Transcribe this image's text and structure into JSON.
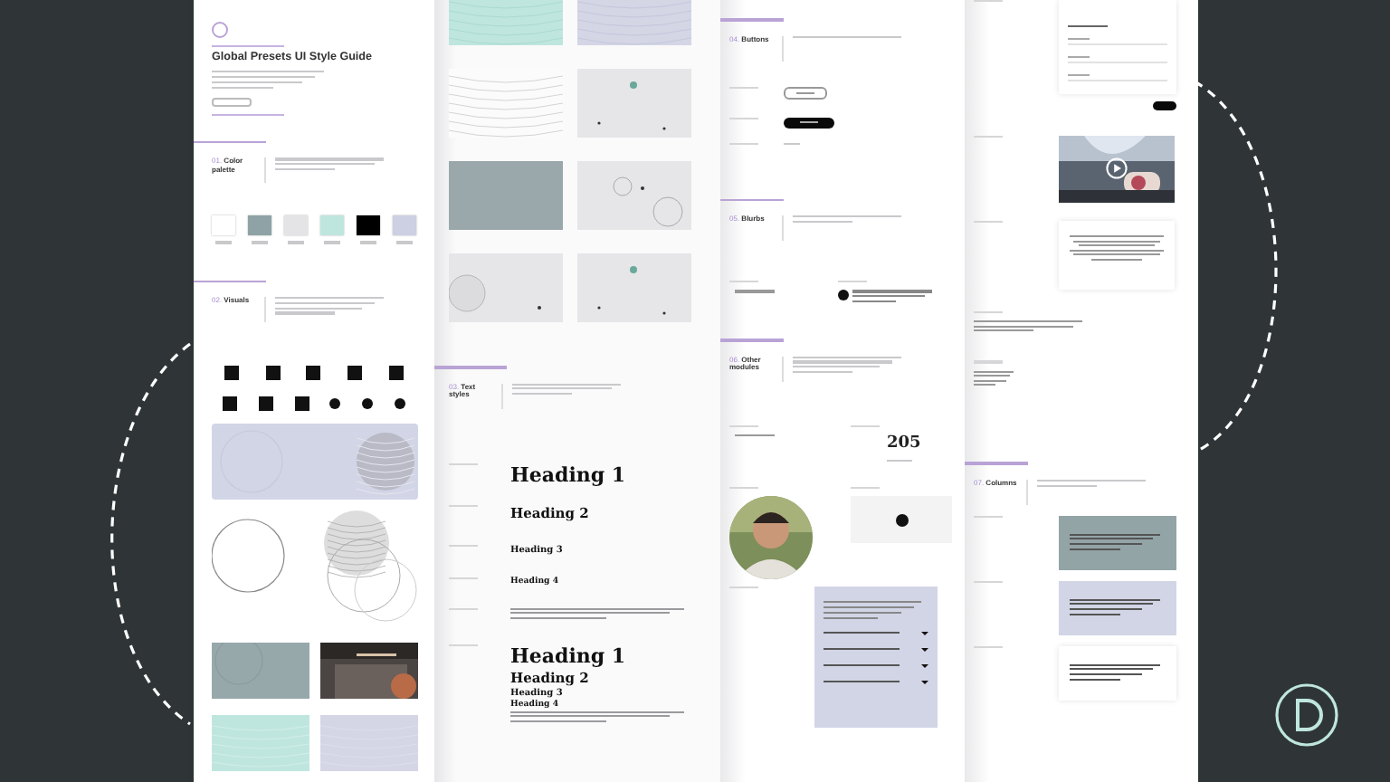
{
  "style_guide": {
    "title": "Global Presets UI Style Guide"
  },
  "sections": [
    {
      "number": "01.",
      "name": "Color palette"
    },
    {
      "number": "02.",
      "name": "Visuals"
    },
    {
      "number": "03.",
      "name": "Text styles"
    },
    {
      "number": "04.",
      "name": "Buttons"
    },
    {
      "number": "05.",
      "name": "Blurbs"
    },
    {
      "number": "06.",
      "name": "Other modules"
    },
    {
      "number": "07.",
      "name": "Columns"
    }
  ],
  "swatches": [
    {
      "color": "#ffffff"
    },
    {
      "color": "#8fa3a6"
    },
    {
      "color": "#e4e4e6"
    },
    {
      "color": "#bfe6de"
    },
    {
      "color": "#000000"
    },
    {
      "color": "#ccd0e2"
    }
  ],
  "text_styles": {
    "headings": [
      "Heading 1",
      "Heading 2",
      "Heading 3",
      "Heading 4"
    ],
    "all_headings": [
      "Heading 1",
      "Heading 2",
      "Heading 3",
      "Heading 4"
    ]
  },
  "counter": {
    "value": "205"
  }
}
